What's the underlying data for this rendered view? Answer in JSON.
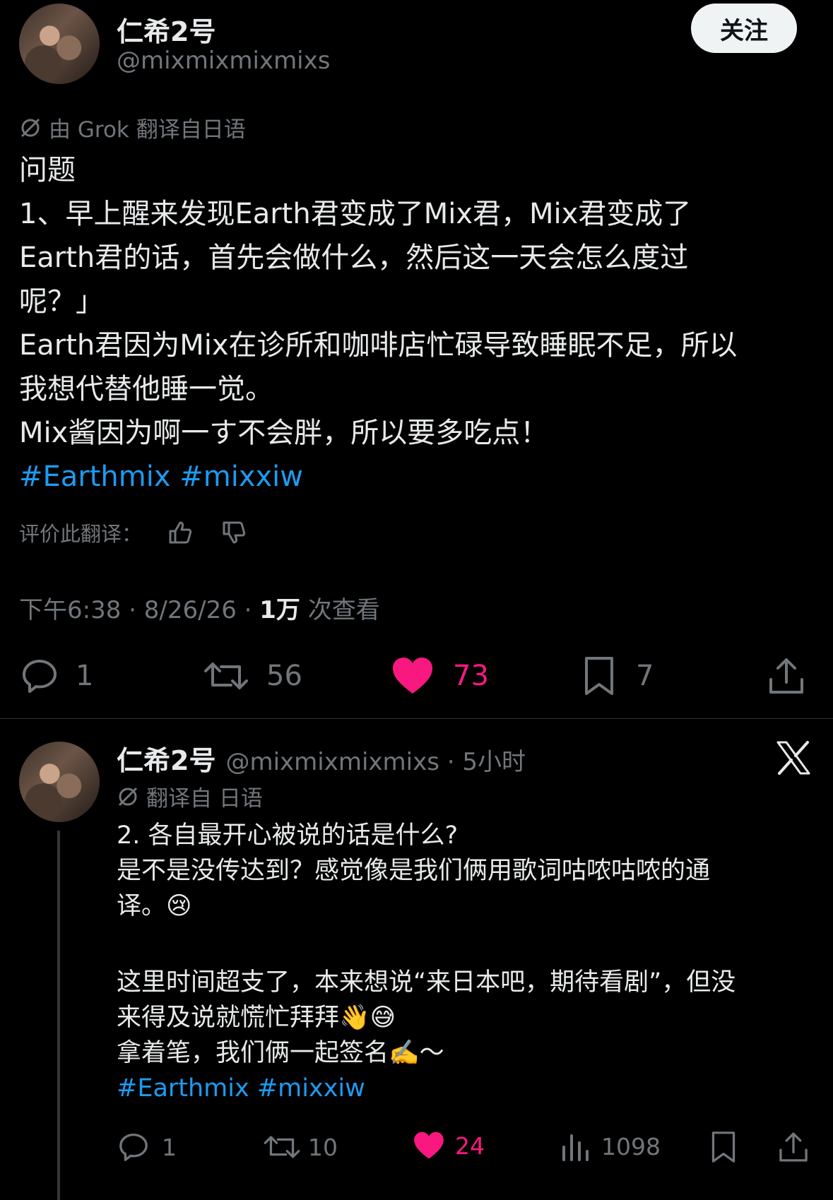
{
  "tweet": {
    "author_name": "仁希2号",
    "author_handle": "@mixmixmixmixs",
    "follow_label": "关注",
    "translation_note": "由 Grok 翻译自日语",
    "lines": [
      "问题",
      "1、早上醒来发现Earth君变成了Mix君，Mix君变成了",
      "Earth君的话，首先会做什么，然后这一天会怎么度过",
      "呢？」",
      "Earth君因为Mix在诊所和咖啡店忙碌导致睡眠不足，所以",
      "我想代替他睡一觉。",
      "Mix酱因为啊一す不会胖，所以要多吃点！"
    ],
    "hashtags": "#Earthmix #mixxiw",
    "rate_label": "评价此翻译：",
    "time": "下午6:38 · 8/26/26 · ",
    "views_count": "1万",
    "views_label": " 次查看",
    "replies": "1",
    "retweets": "56",
    "likes": "73",
    "bookmarks": "7",
    "like_color": "#f91880"
  },
  "reply": {
    "author_name": "仁希2号",
    "author_handle": "@mixmixmixmixs · 5小时",
    "translation_note": "翻译自 日语",
    "lines": [
      "2. 各自最开心被说的话是什么?",
      "是不是没传达到？感觉像是我们俩用歌词咕哝咕哝的通",
      "译。😢",
      "",
      "这里时间超支了，本来想说“来日本吧，期待看剧”，但没",
      "来得及说就慌忙拜拜👋😅",
      "拿着笔，我们俩一起签名✍️～"
    ],
    "hashtags": "#Earthmix #mixxiw",
    "replies": "1",
    "retweets": "10",
    "likes": "24",
    "views": "1098"
  }
}
